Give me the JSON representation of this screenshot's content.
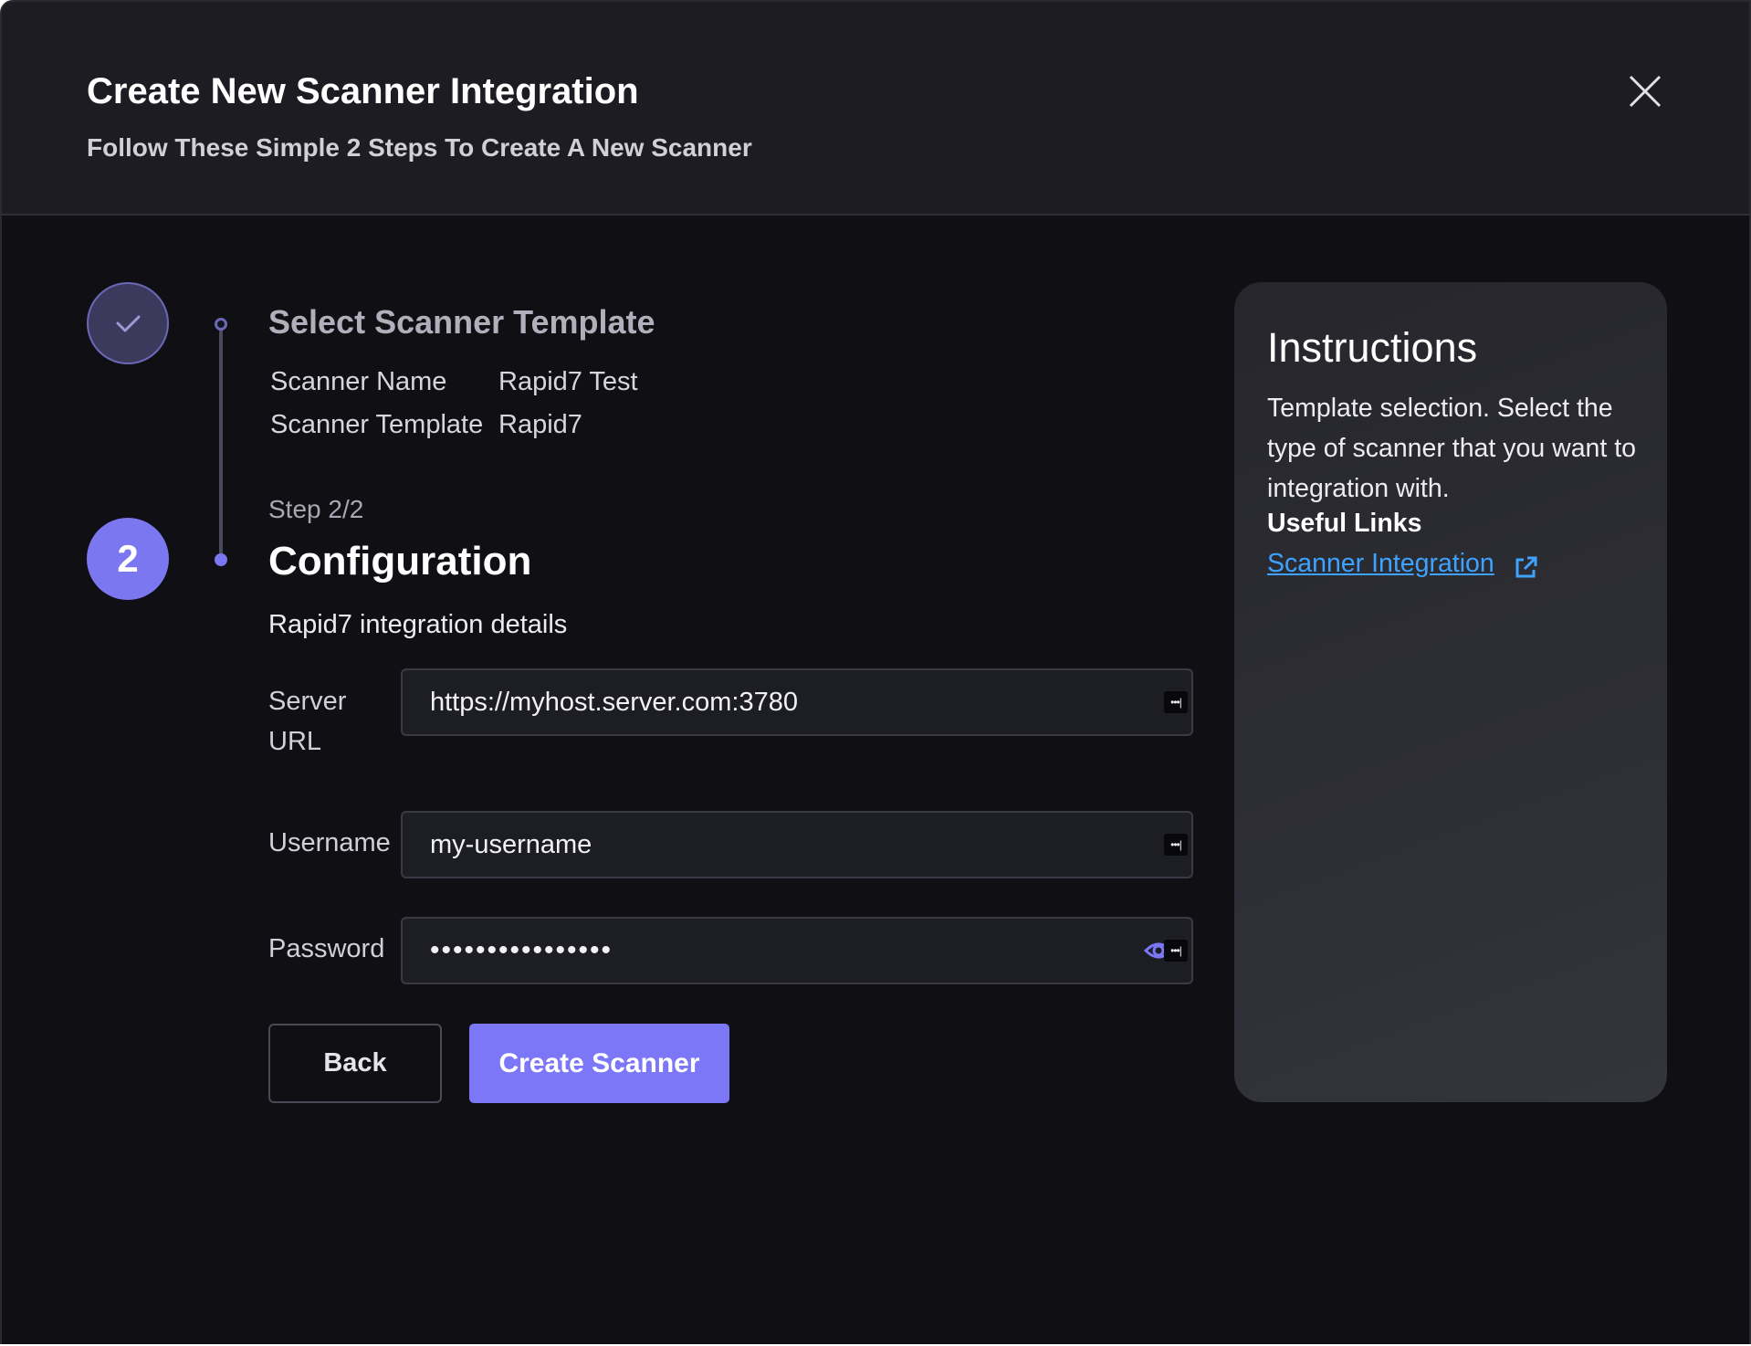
{
  "header": {
    "title": "Create New Scanner Integration",
    "subtitle": "Follow These Simple 2 Steps To Create A New Scanner"
  },
  "stepper": {
    "step1": {
      "title": "Select Scanner Template",
      "summary": [
        {
          "label": "Scanner Name",
          "value": "Rapid7 Test"
        },
        {
          "label": "Scanner Template",
          "value": "Rapid7"
        }
      ]
    },
    "step2": {
      "number": "2",
      "counter": "Step 2/2",
      "title": "Configuration",
      "description": "Rapid7 integration details"
    }
  },
  "form": {
    "server_url": {
      "label": "Server URL",
      "value": "https://myhost.server.com:3780"
    },
    "username": {
      "label": "Username",
      "value": "my-username"
    },
    "password": {
      "label": "Password",
      "value": "••••••••••••••••"
    },
    "menu_glyph": "•••|"
  },
  "buttons": {
    "back": "Back",
    "create": "Create Scanner"
  },
  "instructions": {
    "title": "Instructions",
    "text": "Template selection. Select the type of scanner that you want to integration with.",
    "links_title": "Useful Links",
    "link_label": "Scanner Integration"
  },
  "colors": {
    "accent": "#7b77f7",
    "background": "#0f0f14",
    "header": "#1c1c22",
    "link": "#3ea2ff"
  },
  "icons": [
    "close-icon",
    "checkmark-icon",
    "field-menu-icon",
    "eye-icon",
    "external-link-icon"
  ]
}
